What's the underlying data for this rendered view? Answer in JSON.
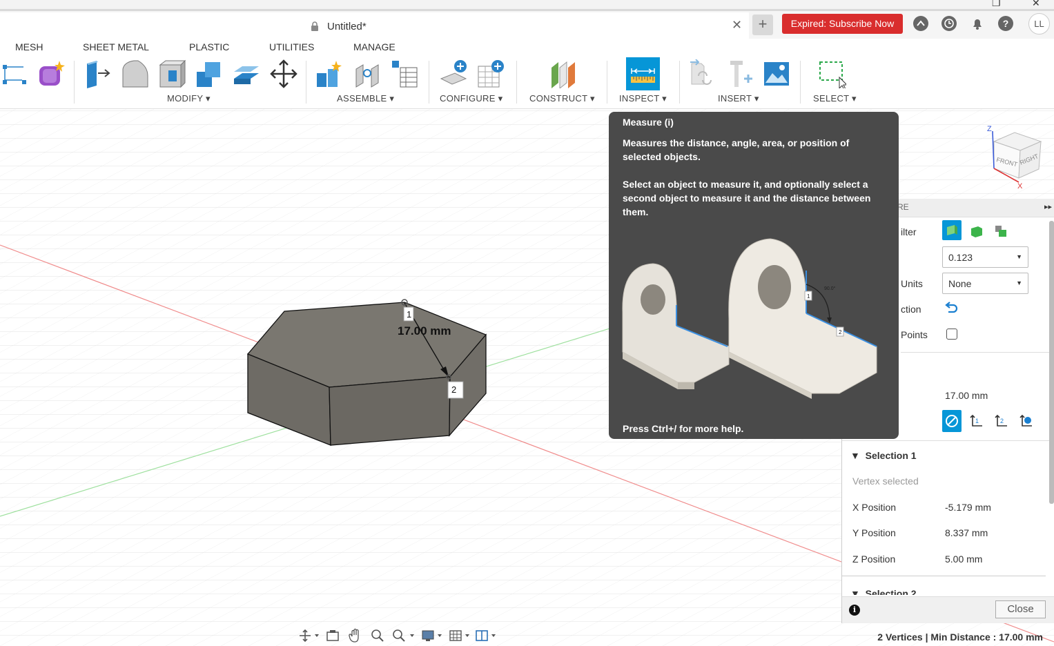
{
  "window": {
    "restore_glyph": "❐",
    "close_glyph": "✕"
  },
  "tab": {
    "title": "Untitled*",
    "close_glyph": "✕",
    "new_tab_glyph": "+"
  },
  "header": {
    "subscribe_label": "Expired: Subscribe Now",
    "avatar_initials": "LL",
    "help_glyph": "?"
  },
  "toolbar": {
    "tabs": [
      "MESH",
      "SHEET METAL",
      "PLASTIC",
      "UTILITIES",
      "MANAGE"
    ],
    "groups": {
      "modify": "MODIFY ▾",
      "assemble": "ASSEMBLE ▾",
      "configure": "CONFIGURE ▾",
      "construct": "CONSTRUCT ▾",
      "inspect": "INSPECT ▾",
      "insert": "INSERT ▾",
      "select": "SELECT ▾"
    }
  },
  "tooltip": {
    "title": "Measure (i)",
    "line1": "Measures the distance, angle, area, or position of selected objects.",
    "line2": "Select an object to measure it, and optionally select a second object to measure it and the distance between them.",
    "help": "Press Ctrl+/ for more help.",
    "image_angle": "90.0°",
    "image_p1": "1",
    "image_p2": "2"
  },
  "canvas": {
    "dimension_label": "17.00 mm",
    "point1": "1",
    "point2": "2",
    "viewcube": {
      "front": "FRONT",
      "right": "RIGHT",
      "z": "Z",
      "x": "X"
    }
  },
  "panel": {
    "title": "RE",
    "expand_glyph": "▸▸",
    "filter_label": "ilter",
    "precision_value": "0.123",
    "units_label": "Units",
    "units_value": "None",
    "direction_label": "ction",
    "points_label": "Points",
    "distance_value": "17.00 mm",
    "selection1": {
      "header": "Selection 1",
      "status": "Vertex selected",
      "rows": [
        {
          "label": "X Position",
          "value": "-5.179 mm"
        },
        {
          "label": "Y Position",
          "value": "8.337 mm"
        },
        {
          "label": "Z Position",
          "value": "5.00 mm"
        }
      ]
    },
    "selection2_header": "Selection 2",
    "close_label": "Close",
    "info_glyph": "i"
  },
  "status": {
    "text": "2 Vertices | Min Distance : 17.00 mm"
  },
  "colors": {
    "accent_blue": "#0696d7",
    "expired_red": "#d92d2d",
    "tooltip_bg": "#4a4a4a",
    "solid_top": "#7a7770",
    "solid_side": "#6b6862"
  }
}
